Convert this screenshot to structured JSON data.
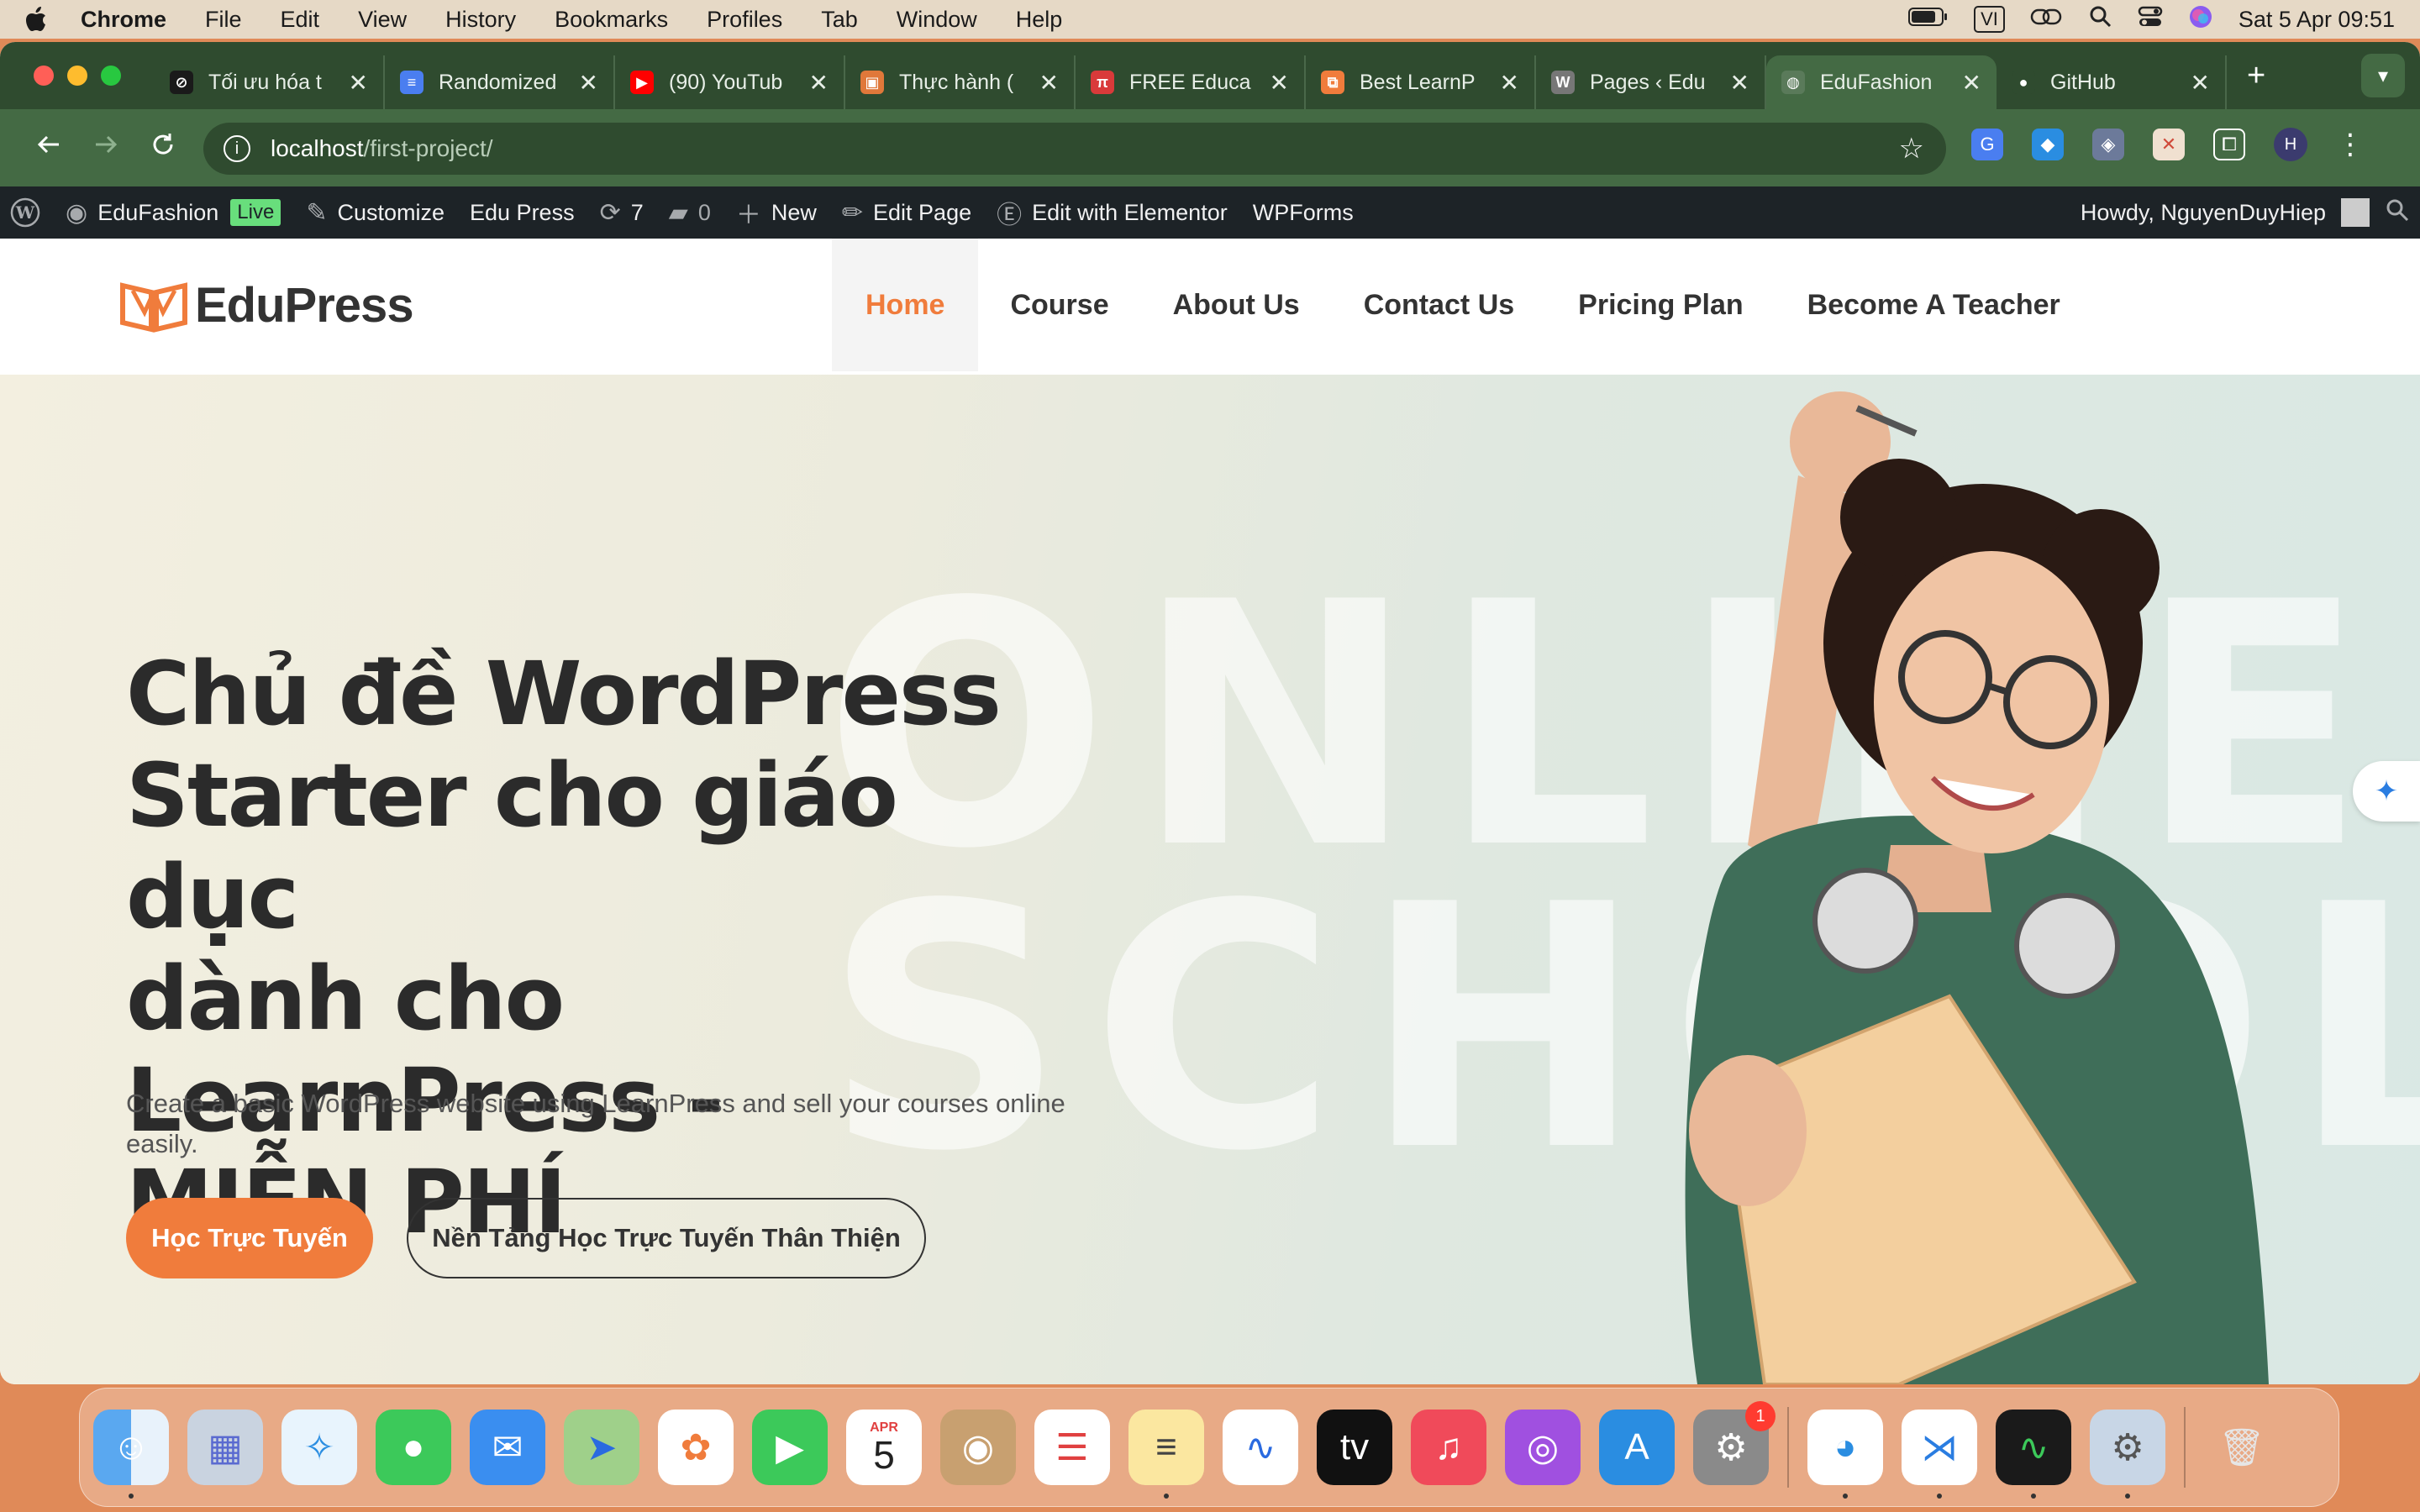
{
  "menubar": {
    "app": "Chrome",
    "items": [
      "File",
      "Edit",
      "View",
      "History",
      "Bookmarks",
      "Profiles",
      "Tab",
      "Window",
      "Help"
    ],
    "input_source": "VI",
    "datetime": "Sat 5 Apr  09:51"
  },
  "tabs": [
    {
      "title": "Tối ưu hóa t",
      "fav_color": "#1a1a1a",
      "fav_glyph": "⊘"
    },
    {
      "title": "Randomized",
      "fav_color": "#4a7ef0",
      "fav_glyph": "≡"
    },
    {
      "title": "(90) YouTub",
      "fav_color": "#ff0000",
      "fav_glyph": "▶"
    },
    {
      "title": "Thực hành (",
      "fav_color": "#e0783a",
      "fav_glyph": "▣"
    },
    {
      "title": "FREE Educa",
      "fav_color": "#d93a3a",
      "fav_glyph": "π"
    },
    {
      "title": "Best LearnP",
      "fav_color": "#f07c3c",
      "fav_glyph": "⧉"
    },
    {
      "title": "Pages ‹ Edu",
      "fav_color": "#777777",
      "fav_glyph": "W"
    },
    {
      "title": "EduFashion",
      "fav_color": "#5a7a5a",
      "fav_glyph": "◍",
      "active": true
    },
    {
      "title": "GitHub",
      "fav_color": "#2f4b2f",
      "fav_glyph": "●"
    }
  ],
  "address": {
    "host": "localhost",
    "path": "/first-project/"
  },
  "profile_initial": "H",
  "adminbar": {
    "site": "EduFashion",
    "live": "Live",
    "customize": "Customize",
    "theme": "Edu Press",
    "updates": "7",
    "comments": "0",
    "new": "New",
    "edit_page": "Edit Page",
    "elementor": "Edit with Elementor",
    "wpforms": "WPForms",
    "howdy": "Howdy, NguyenDuyHiep"
  },
  "site": {
    "logo_text": "EduPress",
    "nav": [
      "Home",
      "Course",
      "About Us",
      "Contact Us",
      "Pricing Plan",
      "Become A Teacher"
    ]
  },
  "hero": {
    "title_lines": [
      "Chủ đề WordPress",
      "Starter cho giáo dục",
      "dành cho LearnPress -",
      "MIỄN PHÍ"
    ],
    "subtitle": "Create a basic WordPress website using LearnPress and sell your courses online easily.",
    "primary_button": "Học Trực Tuyến",
    "secondary_button": "Nền Tảng Học Trực Tuyến Thân Thiện",
    "watermark_lines": [
      "ONLINE",
      "SCHOOL"
    ]
  },
  "dock": {
    "calendar_month": "APR",
    "calendar_day": "5",
    "settings_badge": "1"
  },
  "colors": {
    "accent": "#f07c3c",
    "tab_bg": "#2f4b2f",
    "toolbar_bg": "#446a44",
    "adminbar_bg": "#1d2327"
  }
}
